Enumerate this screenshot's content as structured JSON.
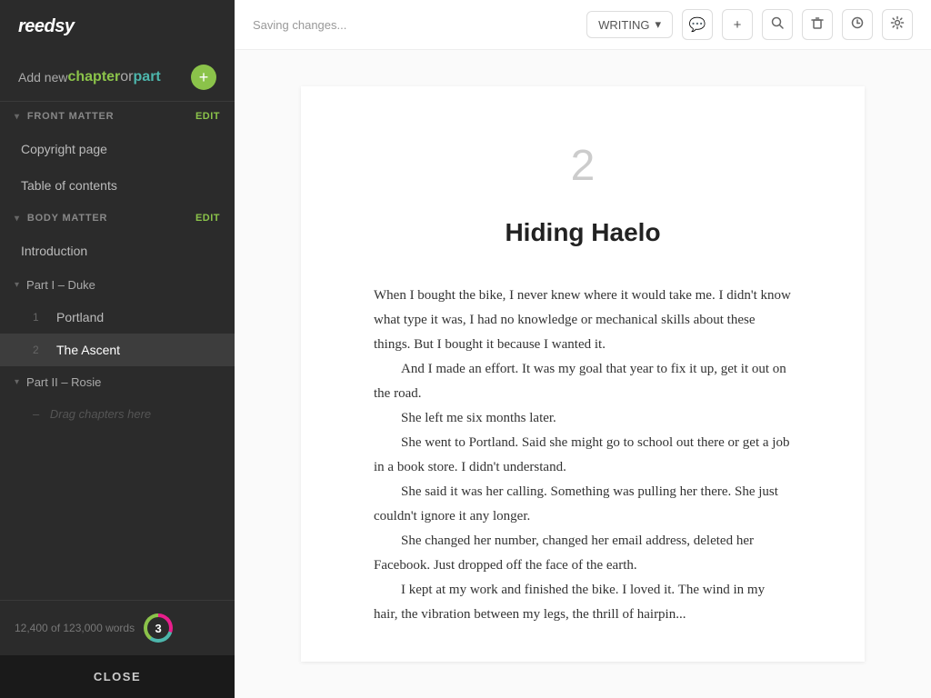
{
  "app": {
    "logo": "reedsy"
  },
  "sidebar": {
    "add_new_label_prefix": "Add new ",
    "add_new_chapter": "chapter",
    "add_new_or": " or ",
    "add_new_part": "part",
    "plus_icon": "+",
    "front_matter": {
      "label": "FRONT MATTER",
      "edit_label": "EDIT",
      "items": [
        {
          "id": "copyright",
          "label": "Copyright page"
        },
        {
          "id": "toc",
          "label": "Table of contents"
        }
      ]
    },
    "body_matter": {
      "label": "BODY MATTER",
      "edit_label": "EDIT",
      "items": [
        {
          "id": "introduction",
          "label": "Introduction"
        }
      ]
    },
    "parts": [
      {
        "id": "part1",
        "label": "Part I – Duke",
        "chapters": [
          {
            "num": "1",
            "label": "Portland"
          },
          {
            "num": "2",
            "label": "The Ascent",
            "active": true
          }
        ]
      },
      {
        "id": "part2",
        "label": "Part II – Rosie",
        "chapters": []
      }
    ],
    "drag_placeholder": "Drag chapters here",
    "footer": {
      "word_count": "12,400 of 123,000 words",
      "badge_number": "3"
    },
    "close_label": "CLOSE"
  },
  "toolbar": {
    "saving_status": "Saving changes...",
    "writing_dropdown_label": "WRITING",
    "chevron_down": "▾",
    "comment_icon": "💬",
    "plus_icon": "+",
    "search_icon": "🔍",
    "trash_icon": "🗑",
    "history_icon": "⏱",
    "settings_icon": "⚙"
  },
  "editor": {
    "chapter_number": "2",
    "chapter_title": "Hiding Haelo",
    "paragraphs": [
      {
        "type": "normal",
        "text": "When I bought the bike, I never knew where it would take me. I didn't know what type it was, I had no knowledge or mechanical skills about these things. But I bought it because I wanted it."
      },
      {
        "type": "indent",
        "text": "And I made an effort. It was my goal that year to fix it up, get it out on the road."
      },
      {
        "type": "indent",
        "text": "She left me six months later."
      },
      {
        "type": "indent",
        "text": "She went to Portland. Said she might go to school out there or get a job in a book store. I didn't understand."
      },
      {
        "type": "indent",
        "text": "She said it was her calling. Something was pulling her there. She just couldn't ignore it any longer."
      },
      {
        "type": "indent",
        "text": "She changed her number, changed her email address, deleted her Facebook. Just dropped off the face of the earth."
      },
      {
        "type": "indent",
        "text": "I kept at my work and finished the bike. I loved it. The wind in my hair, the vibration between my legs, the thrill of hairpin..."
      }
    ]
  }
}
